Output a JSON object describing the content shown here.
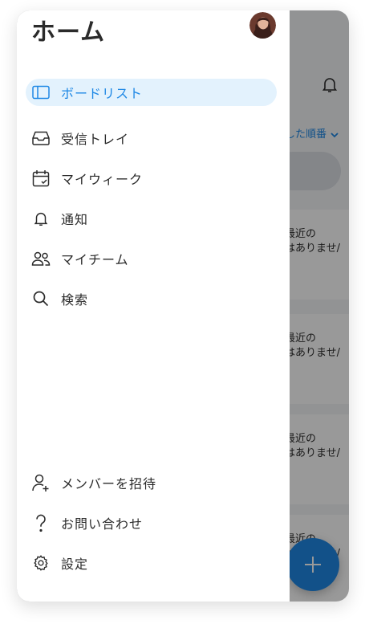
{
  "drawer": {
    "title": "ホーム",
    "avatar_icon": "user-avatar",
    "nav_items": [
      {
        "label": "ボードリスト",
        "icon": "board-list-icon",
        "active": true
      },
      {
        "label": "受信トレイ",
        "icon": "inbox-icon",
        "active": false
      },
      {
        "label": "マイウィーク",
        "icon": "calendar-check-icon",
        "active": false
      },
      {
        "label": "通知",
        "icon": "bell-icon",
        "active": false
      },
      {
        "label": "マイチーム",
        "icon": "team-icon",
        "active": false
      },
      {
        "label": "検索",
        "icon": "search-icon",
        "active": false
      }
    ],
    "bottom_items": [
      {
        "label": "メンバーを招待",
        "icon": "add-user-icon"
      },
      {
        "label": "お問い合わせ",
        "icon": "question-icon"
      },
      {
        "label": "設定",
        "icon": "gear-icon"
      }
    ]
  },
  "background": {
    "sort_label": "した順番",
    "cards": [
      {
        "line1": "最近の",
        "line2": "はありませ/"
      },
      {
        "line1": "最近の",
        "line2": "はありませ/"
      },
      {
        "line1": "最近の",
        "line2": "はありませ/"
      },
      {
        "line1": "最近の",
        "line2": "はありませ/"
      }
    ],
    "fab_icon": "plus-icon"
  },
  "colors": {
    "accent": "#1e88e5",
    "active_bg": "#e3f2fd",
    "text": "#2b2b2b",
    "overlay": "rgba(0,0,0,0.40)"
  }
}
